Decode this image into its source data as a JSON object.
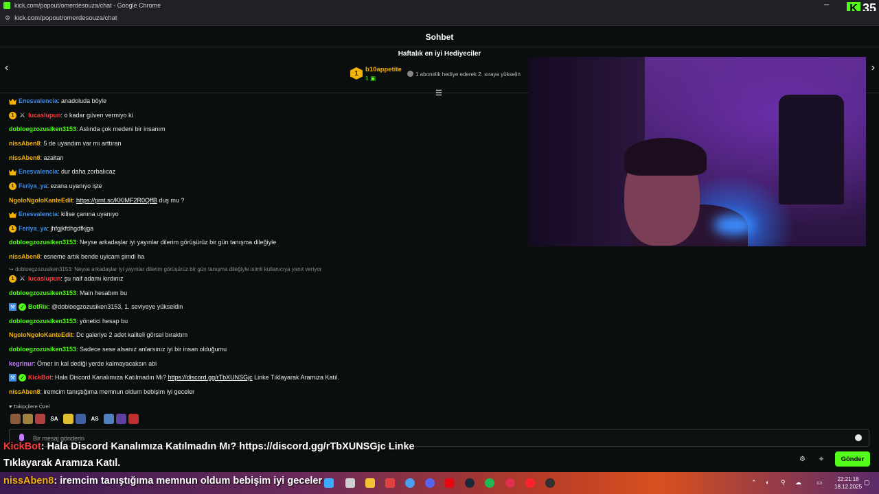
{
  "window": {
    "title": "kick.com/popout/omerdesouza/chat - Google Chrome",
    "url": "kick.com/popout/omerdesouza/chat",
    "kick_counter": "35"
  },
  "header": {
    "title": "Sohbet"
  },
  "gifters": {
    "title": "Haftalık en iyi Hediyeciler",
    "top": {
      "rank": "1",
      "name": "b10appetite",
      "count": "1"
    },
    "hint": "1 abonelik hediye ederek 2. sıraya yükselin"
  },
  "colors": {
    "kick_green": "#53fc18",
    "gold": "#f2b10b",
    "red_user": "#ff3b3b",
    "blue_user": "#3d8ce6"
  },
  "messages": [
    {
      "badges": [
        "crown"
      ],
      "user": "Enesvalencia",
      "color": "#3d8ce6",
      "text": ": anadoluda böyle"
    },
    {
      "badges": [
        "sub",
        "sword"
      ],
      "user": "lucaslupun",
      "color": "#ff3b3b",
      "text": ": o kadar güven vermiyo ki"
    },
    {
      "badges": [],
      "user": "dobloegzozusiken3153",
      "color": "#53fc18",
      "text": ": Aslında çok medeni bir insanım"
    },
    {
      "badges": [],
      "user": "nissAben8",
      "color": "#f2b10b",
      "text": ": 5 de uyandım var mı arttıran"
    },
    {
      "badges": [],
      "user": "nissAben8",
      "color": "#f2b10b",
      "text": ": azaltan"
    },
    {
      "badges": [
        "crown"
      ],
      "user": "Enesvalencia",
      "color": "#3d8ce6",
      "text": ": dur daha zorbalıcaz"
    },
    {
      "badges": [
        "sub"
      ],
      "user": "Feriya_ya",
      "color": "#3d8ce6",
      "text": ": ezana uyanıyo işte"
    },
    {
      "badges": [],
      "user": "NgoloNgoloKanteEdit",
      "color": "#f2b10b",
      "text": ": ",
      "link": "https://prnt.sc/KKlMF2R0QffB",
      "after": " duş mu ?"
    },
    {
      "badges": [
        "crown"
      ],
      "user": "Enesvalencia",
      "color": "#3d8ce6",
      "text": ": kilise çanına uyanıyo"
    },
    {
      "badges": [
        "sub"
      ],
      "user": "Feriya_ya",
      "color": "#3d8ce6",
      "text": ": jhfgjkfdhgdfkjga"
    },
    {
      "badges": [],
      "user": "dobloegzozusiken3153",
      "color": "#53fc18",
      "text": ": Neyse arkadaşlar iyi yayınlar dilerim görüşürüz bir gün tanışma dileğiyle"
    },
    {
      "badges": [],
      "user": "nissAben8",
      "color": "#f2b10b",
      "text": ": esneme artık bende uyicam şimdi ha"
    },
    {
      "badges": [
        "sub",
        "sword"
      ],
      "user": "lucaslupun",
      "color": "#ff3b3b",
      "text": ": şu naif adamı kırdınız"
    },
    {
      "badges": [],
      "user": "dobloegzozusiken3153",
      "color": "#53fc18",
      "text": ": Main hesabım bu"
    },
    {
      "badges": [
        "mod",
        "verified"
      ],
      "user": "BotRix",
      "color": "#53fc18",
      "text": ": @dobloegzozusiken3153, 1. seviyeye yükseldin"
    },
    {
      "badges": [],
      "user": "dobloegzozusiken3153",
      "color": "#53fc18",
      "text": ": yönetici hesap bu"
    },
    {
      "badges": [],
      "user": "NgoloNgoloKanteEdit",
      "color": "#f2b10b",
      "text": ": Dc galeriye 2 adet kaliteli görsel bıraktım"
    },
    {
      "badges": [],
      "user": "dobloegzozusiken3153",
      "color": "#53fc18",
      "text": ": Sadece sese alsanız anlarsınız iyi bir insan olduğumu"
    },
    {
      "badges": [],
      "user": "kegrinur",
      "color": "#c47bff",
      "text": ": Ömer in kal dediği yerde kalmayacaksın abi"
    },
    {
      "badges": [
        "mod",
        "verified"
      ],
      "user": "KickBot",
      "color": "#ff3b3b",
      "text": ": Hala Discord Kanalımıza Katılmadın Mı? ",
      "link": "https://discord.gg/rTbXUNSGjc",
      "after": " Linke Tıklayarak Aramıza Katıl."
    },
    {
      "badges": [],
      "user": "nissAben8",
      "color": "#f2b10b",
      "text": ": iremcim tanıştığıma memnun oldum bebişim iyi geceler"
    }
  ],
  "reply_line": "dobloegzozusiken3153: Neyse arkadaşlar iyi yayınlar dilerim görüşürüz bir gün tanışma dileğiyle isimli kullanıcıya yanıt veriyor",
  "followers_label": "Takipçilere Özel",
  "emotes": [
    "SA",
    "AS"
  ],
  "input": {
    "placeholder": "Bir mesaj gönderin"
  },
  "send_label": "Gönder",
  "overlay": {
    "line1_user": "KickBot",
    "line1_text": ": Hala Discord Kanalımıza Katılmadın Mı? https://discord.gg/rTbXUNSGjc Linke",
    "line2_text": "Tıklayarak Aramıza Katıl.",
    "line3_user": "nissAben8",
    "line3_text": ": iremcim tanıştığıma memnun oldum bebişim iyi geceler"
  },
  "clock": {
    "time": "22:21:18",
    "date": "18.12.2025"
  }
}
